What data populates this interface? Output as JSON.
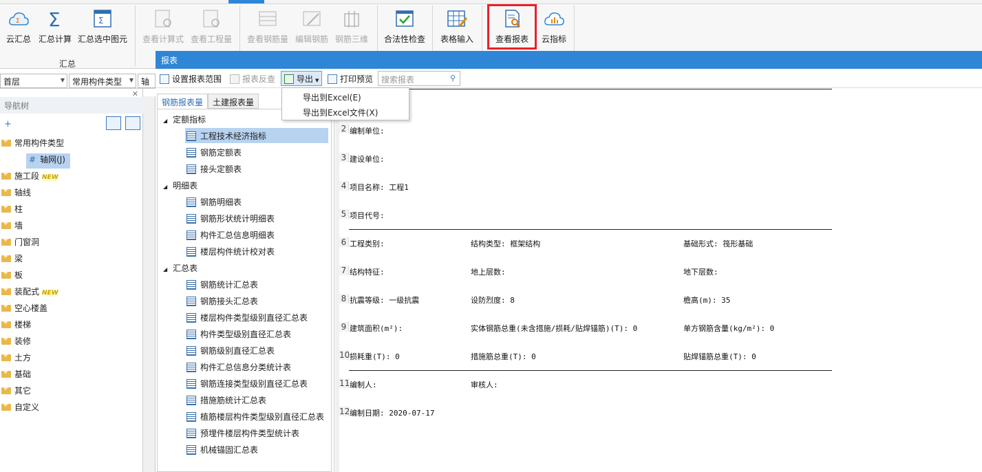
{
  "ribbon": {
    "buttons": {
      "cloud_sum": "云汇总",
      "sum_calc": "汇总计算",
      "sum_selected": "汇总选中图元",
      "view_formula": "查看计算式",
      "view_quantity": "查看工程量",
      "view_rebar": "查看钢筋量",
      "edit_rebar": "编辑钢筋",
      "rebar_3d": "钢筋三维",
      "legality_check": "合法性检查",
      "table_input": "表格输入",
      "view_report": "查看报表",
      "cloud_index": "云指标"
    },
    "group_sum": "汇总"
  },
  "left": {
    "floor": "首层",
    "component_type": "常用构件类型",
    "axis": "轴网",
    "nav_title": "导航树",
    "nav_items": [
      {
        "label": "常用构件类型",
        "new": false
      },
      {
        "label": "轴网(J)",
        "new": false
      },
      {
        "label": "施工段",
        "new": true
      },
      {
        "label": "轴线",
        "new": false
      },
      {
        "label": "柱",
        "new": false
      },
      {
        "label": "墙",
        "new": false
      },
      {
        "label": "门窗洞",
        "new": false
      },
      {
        "label": "梁",
        "new": false
      },
      {
        "label": "板",
        "new": false
      },
      {
        "label": "装配式",
        "new": true
      },
      {
        "label": "空心楼盖",
        "new": false
      },
      {
        "label": "楼梯",
        "new": false
      },
      {
        "label": "装修",
        "new": false
      },
      {
        "label": "土方",
        "new": false
      },
      {
        "label": "基础",
        "new": false
      },
      {
        "label": "其它",
        "new": false
      },
      {
        "label": "自定义",
        "new": false
      }
    ],
    "new_badge": "NEW"
  },
  "report": {
    "title": "报表",
    "toolbar": {
      "set_range": "设置报表范围",
      "reverse": "报表反查",
      "export": "导出",
      "print_preview": "打印预览",
      "search_placeholder": "搜索报表"
    },
    "export_menu": [
      "导出到Excel(E)",
      "导出到Excel文件(X)"
    ],
    "tabs": [
      "钢筋报表量",
      "土建报表量"
    ],
    "sections": [
      {
        "title": "定额指标",
        "items": [
          "工程技术经济指标",
          "钢筋定额表",
          "接头定额表"
        ]
      },
      {
        "title": "明细表",
        "items": [
          "钢筋明细表",
          "钢筋形状统计明细表",
          "构件汇总信息明细表",
          "楼层构件统计校对表"
        ]
      },
      {
        "title": "汇总表",
        "items": [
          "钢筋统计汇总表",
          "钢筋接头汇总表",
          "楼层构件类型级别直径汇总表",
          "构件类型级别直径汇总表",
          "钢筋级别直径汇总表",
          "构件汇总信息分类统计表",
          "钢筋连接类型级别直径汇总表",
          "措施筋统计汇总表",
          "植筋楼层构件类型级别直径汇总表",
          "预埋件楼层构件类型统计表",
          "机械锚固汇总表"
        ]
      }
    ],
    "rows": [
      {
        "n": "2",
        "cells": [
          "编制单位:"
        ]
      },
      {
        "n": "3",
        "cells": [
          "建设单位:"
        ]
      },
      {
        "n": "4",
        "cells": [
          "项目名称: 工程1"
        ]
      },
      {
        "n": "5",
        "cells": [
          "项目代号:"
        ]
      },
      {
        "n": "6",
        "cells": [
          "工程类别:",
          "结构类型: 框架结构",
          "基础形式: 筏形基础"
        ]
      },
      {
        "n": "7",
        "cells": [
          "结构特征:",
          "地上层数:",
          "地下层数:"
        ]
      },
      {
        "n": "8",
        "cells": [
          "抗震等级: 一级抗震",
          "设防烈度: 8",
          "檐高(m): 35"
        ]
      },
      {
        "n": "9",
        "cells": [
          "建筑面积(m²):",
          "实体钢筋总重(未含措施/损耗/贴焊锚筋)(T): 0",
          "单方钢筋含量(kg/m²): 0"
        ]
      },
      {
        "n": "10",
        "cells": [
          "损耗重(T): 0",
          "措施筋总重(T): 0",
          "贴焊锚筋总重(T): 0"
        ]
      },
      {
        "n": "11",
        "cells": [
          "编制人:",
          "审核人:"
        ]
      },
      {
        "n": "12",
        "cells": [
          "编制日期: 2020-07-17"
        ]
      }
    ]
  }
}
